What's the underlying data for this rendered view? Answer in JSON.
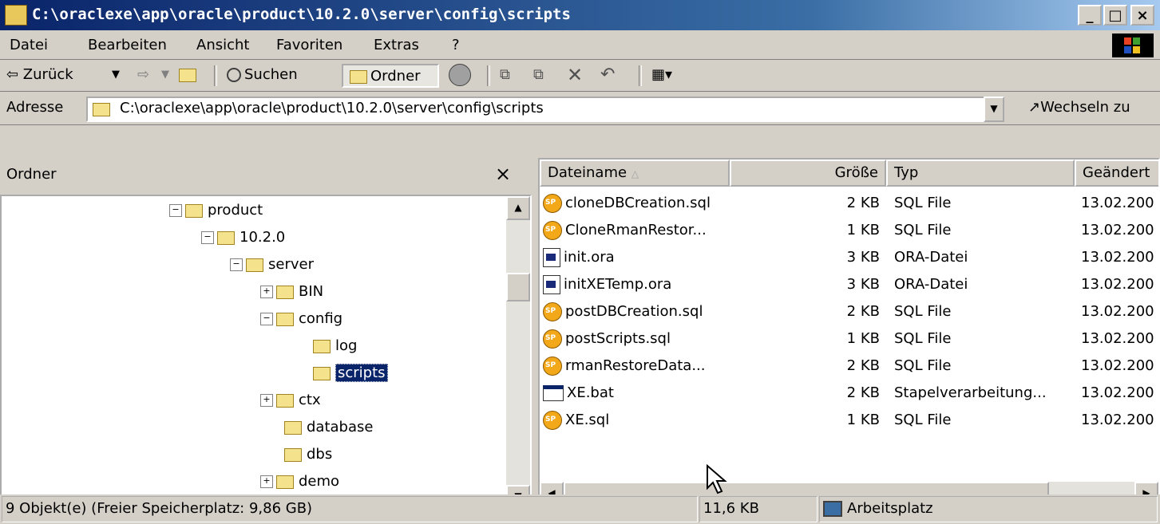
{
  "window": {
    "title": "C:\\oraclexe\\app\\oracle\\product\\10.2.0\\server\\config\\scripts",
    "minimize": "_",
    "maximize": "□",
    "close": "×"
  },
  "menu": [
    "Datei",
    "Bearbeiten",
    "Ansicht",
    "Favoriten",
    "Extras",
    "?"
  ],
  "toolbar": {
    "back": "⇦ Zurück",
    "search": "Suchen",
    "folders": "Ordner"
  },
  "address": {
    "label": "Adresse",
    "value": "C:\\oraclexe\\app\\oracle\\product\\10.2.0\\server\\config\\scripts",
    "go": "Wechseln zu"
  },
  "tree": {
    "header": "Ordner",
    "close": "×",
    "items": [
      "product",
      "10.2.0",
      "server",
      "BIN",
      "config",
      "log",
      "scripts",
      "ctx",
      "database",
      "dbs",
      "demo"
    ]
  },
  "list": {
    "columns": [
      "Dateiname",
      "Größe",
      "Typ",
      "Geändert"
    ],
    "rows": [
      {
        "name": "cloneDBCreation.sql",
        "size": "2 KB",
        "type": "SQL File",
        "modified": "13.02.200"
      },
      {
        "name": "CloneRmanRestor...",
        "size": "1 KB",
        "type": "SQL File",
        "modified": "13.02.200"
      },
      {
        "name": "init.ora",
        "size": "3 KB",
        "type": "ORA-Datei",
        "modified": "13.02.200"
      },
      {
        "name": "initXETemp.ora",
        "size": "3 KB",
        "type": "ORA-Datei",
        "modified": "13.02.200"
      },
      {
        "name": "postDBCreation.sql",
        "size": "2 KB",
        "type": "SQL File",
        "modified": "13.02.200"
      },
      {
        "name": "postScripts.sql",
        "size": "1 KB",
        "type": "SQL File",
        "modified": "13.02.200"
      },
      {
        "name": "rmanRestoreData...",
        "size": "2 KB",
        "type": "SQL File",
        "modified": "13.02.200"
      },
      {
        "name": "XE.bat",
        "size": "2 KB",
        "type": "Stapelverarbeitung...",
        "modified": "13.02.200"
      },
      {
        "name": "XE.sql",
        "size": "1 KB",
        "type": "SQL File",
        "modified": "13.02.200"
      }
    ]
  },
  "status": {
    "objects": "9 Objekt(e) (Freier Speicherplatz: 9,86 GB)",
    "size": "11,6 KB",
    "location": "Arbeitsplatz"
  }
}
